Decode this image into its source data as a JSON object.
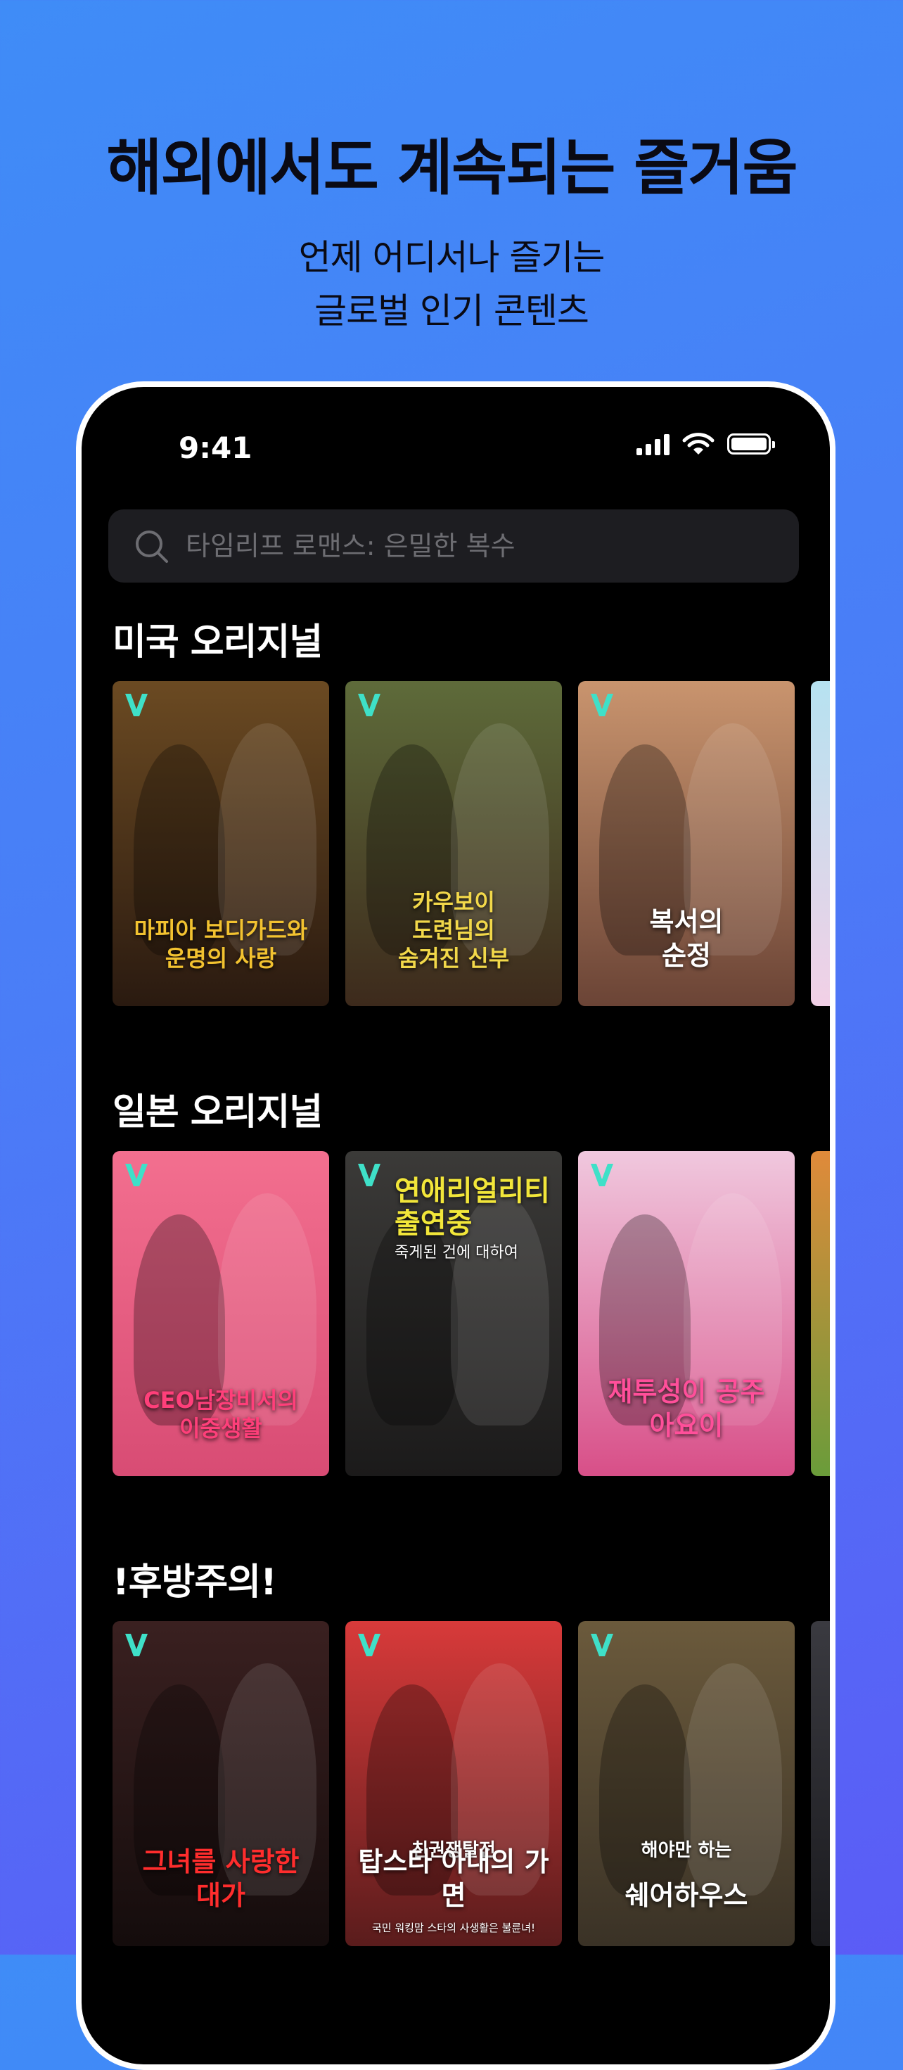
{
  "headline": "해외에서도 계속되는 즐거움",
  "sublines": [
    "언제 어디서나 즐기는",
    "글로벌 인기 콘텐츠"
  ],
  "status_bar": {
    "time": "9:41",
    "icons": [
      "cellular-signal-icon",
      "wifi-icon",
      "battery-icon"
    ]
  },
  "search": {
    "placeholder": "타임리프 로맨스: 은밀한 복수",
    "icon": "search-icon"
  },
  "sections": [
    {
      "title": "미국 오리지널",
      "cards": [
        {
          "title": "마피아 보디가드와\n운명의 사랑",
          "colors": [
            "#6b4a22",
            "#2a1a10"
          ],
          "accent": "#f2c230"
        },
        {
          "title": "카우보이\n도련님의\n숨겨진 신부",
          "colors": [
            "#5e6b3a",
            "#3d2a1c"
          ],
          "accent": "#f2d84a"
        },
        {
          "title": "복서의\n순정",
          "colors": [
            "#c9946e",
            "#6b4436"
          ],
          "accent": "#ffffff"
        }
      ],
      "peek_colors": [
        "#b6e2f0",
        "#f2d0e6"
      ]
    },
    {
      "title": "일본 오리지널",
      "cards": [
        {
          "title": "CEO남장비서의\n이중생활",
          "colors": [
            "#f36f8f",
            "#d84c74"
          ],
          "accent": "#ff3f7a"
        },
        {
          "title": "",
          "top_text": "연애리얼리티\n출연중",
          "top_sub": "죽게된 건에 대하여",
          "colors": [
            "#3b3a38",
            "#1b1a1a"
          ],
          "accent": "#f2e63a"
        },
        {
          "title": "재투성이 공주\n아요이",
          "colors": [
            "#f0c8de",
            "#d84f88"
          ],
          "accent": "#ff4f9a"
        }
      ],
      "peek_colors": [
        "#e08a3a",
        "#6a9c3a"
      ]
    },
    {
      "title": "!후방주의!",
      "cards": [
        {
          "title": "그녀를 사랑한\n대가",
          "colors": [
            "#3a2020",
            "#140c0c"
          ],
          "accent": "#ff2d2d"
        },
        {
          "title": "탑스타 아내의 가면",
          "top_label": "친권쟁탈전",
          "caption": "국민 워킹맘 스타의 사생활은 불륜녀!",
          "colors": [
            "#d83a3a",
            "#5a1c1c"
          ],
          "accent": "#ffffff"
        },
        {
          "title": "쉐어하우스",
          "top_label": "해야만 하는",
          "colors": [
            "#6b5a3c",
            "#3a3226"
          ],
          "accent": "#ffffff"
        }
      ],
      "peek_colors": [
        "#3a3a40",
        "#1a1a1e"
      ]
    }
  ]
}
